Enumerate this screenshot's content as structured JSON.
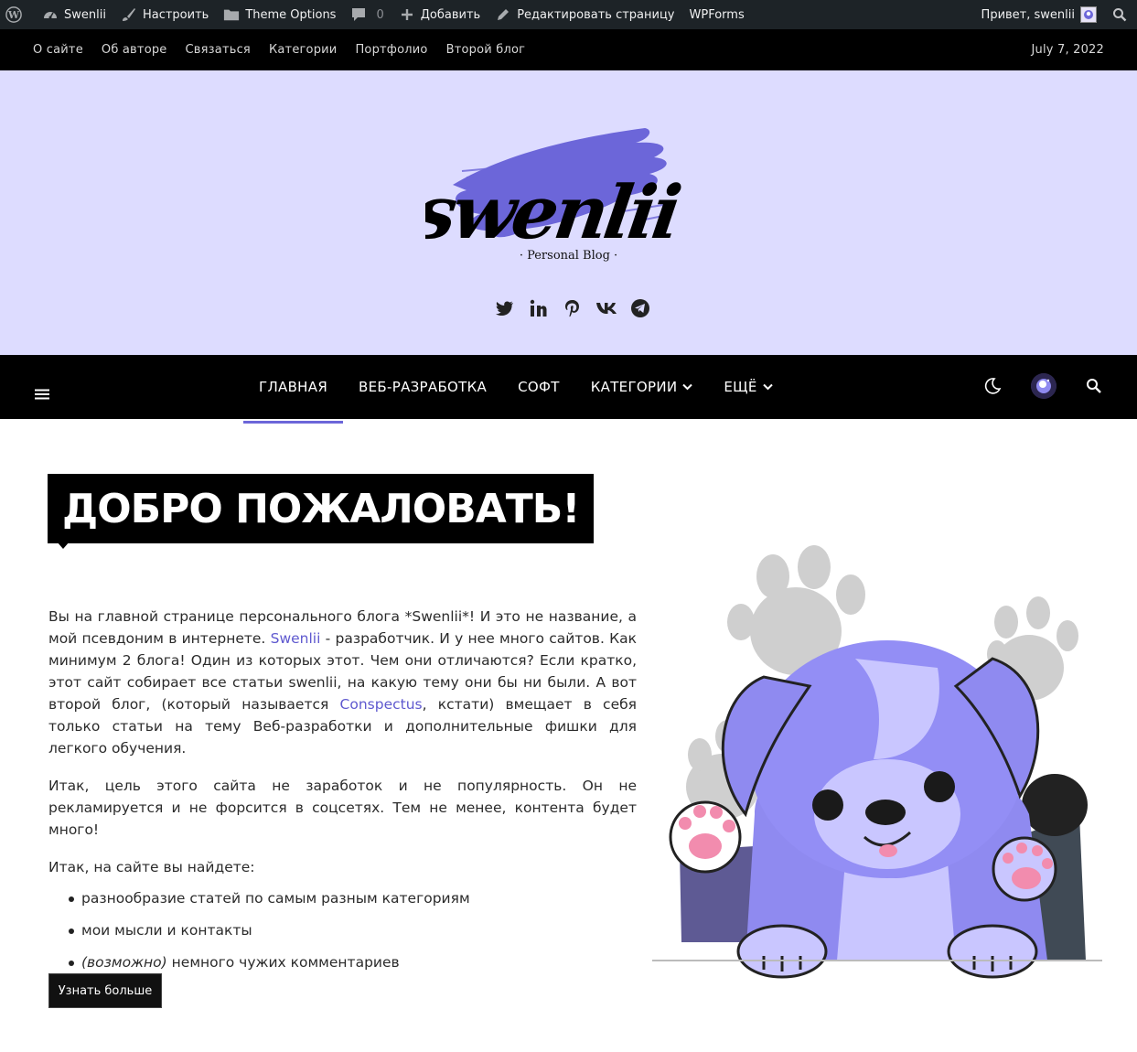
{
  "adminbar": {
    "site": "Swenlii",
    "customize": "Настроить",
    "theme_options": "Theme Options",
    "comments_count": "0",
    "add_new": "Добавить",
    "edit_page": "Редактировать страницу",
    "wpforms": "WPForms",
    "greeting": "Привет, swenlii"
  },
  "topnav": {
    "items": [
      "О сайте",
      "Об авторе",
      "Связаться",
      "Категории",
      "Портфолио",
      "Второй блог"
    ],
    "date": "July 7, 2022"
  },
  "header": {
    "logo_text": "swenlii",
    "tagline": "Personal Blog",
    "accent_color": "#6c66d9",
    "background_color": "#dddcff",
    "socials": [
      "twitter-icon",
      "linkedin-icon",
      "pinterest-icon",
      "vk-icon",
      "telegram-icon"
    ]
  },
  "mainnav": {
    "items": [
      "ГЛАВНАЯ",
      "ВЕБ-РАЗРАБОТКА",
      "СОФТ",
      "КАТЕГОРИИ",
      "ЕЩЁ"
    ],
    "active": "ГЛАВНАЯ"
  },
  "main": {
    "title": "ДОБРО ПОЖАЛОВАТЬ!",
    "p1_a": "Вы на главной странице персонального блога *Swenlii*! И это не название, а мой псевдоним в интернете. ",
    "p1_link1": "Swenlii",
    "p1_b": " - разработчик. И у нее много сайтов. Как минимум 2 блога! Один из которых этот. Чем они отличаются? Если кратко, этот сайт собирает все статьи swenlii, на какую тему они бы ни были. А вот второй блог, (который называется ",
    "p1_link2": "Conspectus",
    "p1_c": ", кстати) вмещает в себя только статьи на тему Веб-разработки и дополнительные фишки для легкого обучения.",
    "p2": "Итак, цель этого сайта не заработок и не популярность. Он не рекламируется и не форсится в соцсетях. Тем не менее, контента будет много!",
    "p3": "Итак, на сайте вы найдете:",
    "list": [
      "разнообразие статей по самым разным категориям",
      "мои мысли и контакты"
    ],
    "list3_em": "(возможно)",
    "list3_rest": " немного чужих комментариев",
    "button": "Узнать больше"
  }
}
